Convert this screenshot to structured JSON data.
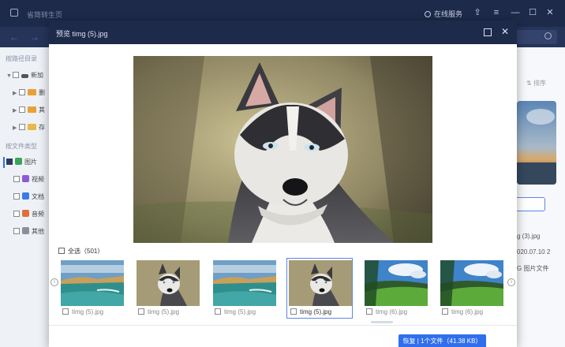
{
  "app": {
    "title": "省简转生页",
    "online_service": "在线服务",
    "win_buttons": [
      "⇪",
      "≡",
      "—",
      "☐",
      "✕"
    ]
  },
  "sidebar": {
    "section_path": "按路径目录",
    "section_type": "按文件类型",
    "tree": [
      {
        "label": "新加",
        "checked": false
      },
      {
        "label": "删",
        "checked": false
      },
      {
        "label": "其",
        "checked": false
      },
      {
        "label": "存",
        "checked": false
      }
    ],
    "types": [
      {
        "label": "图片",
        "checked": true,
        "color": "#3aa55b"
      },
      {
        "label": "视频",
        "checked": false,
        "color": "#8c5ad6"
      },
      {
        "label": "文档",
        "checked": false,
        "color": "#3a7be8"
      },
      {
        "label": "音频",
        "checked": false,
        "color": "#e0703a"
      },
      {
        "label": "其他",
        "checked": false,
        "color": "#8a8f99"
      }
    ]
  },
  "right_pane": {
    "sort_label": "排序",
    "file_name": "g (3).jpg",
    "date": "020.07.10 2",
    "type": "G 图片文件"
  },
  "modal": {
    "title": "预览 timg (5).jpg",
    "select_all": "全选",
    "count": "（501）",
    "thumbnails": [
      {
        "caption": "timg (5).jpg",
        "kind": "beach",
        "selected": false
      },
      {
        "caption": "timg (5).jpg",
        "kind": "husky",
        "selected": false
      },
      {
        "caption": "timg (5).jpg",
        "kind": "beach",
        "selected": false
      },
      {
        "caption": "timg (5).jpg",
        "kind": "husky",
        "selected": true
      },
      {
        "caption": "timg (6).jpg",
        "kind": "field",
        "selected": false
      },
      {
        "caption": "timg (6).jpg",
        "kind": "field",
        "selected": false
      }
    ],
    "recover_button": "恢复 | 1个文件（41.38 KB）"
  },
  "colors": {
    "title_bar": "#1e2a4a",
    "accent": "#2f6fed"
  }
}
